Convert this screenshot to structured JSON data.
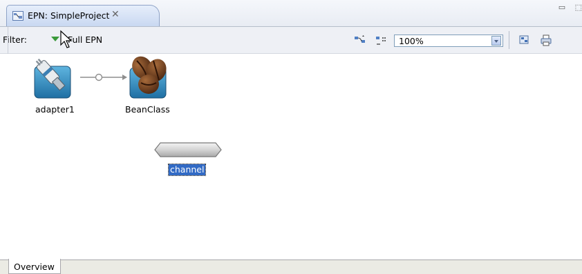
{
  "editor": {
    "tab_title": "EPN: SimpleProject",
    "tab_icon": "epn-diagram-icon",
    "close_glyph": "✕",
    "minimize_glyph": "▭",
    "maximize_glyph": "⬚"
  },
  "toolbar": {
    "filter_label": "Filter:",
    "filter_value": "Full EPN",
    "zoom_value": "100%",
    "icons": [
      "layout-icon",
      "grid-snap-icon",
      "export-image-icon",
      "print-icon"
    ]
  },
  "canvas": {
    "nodes": [
      {
        "id": "adapter1",
        "label": "adapter1",
        "icon": "adapter-plug-icon"
      },
      {
        "id": "beanclass",
        "label": "BeanClass",
        "icon": "coffee-bean-icon"
      },
      {
        "id": "channel",
        "label": "channel",
        "icon": "channel-capsule-icon",
        "selected": true
      }
    ],
    "connections": [
      {
        "from": "adapter1",
        "to": "BeanClass"
      }
    ]
  },
  "bottom_tabs": {
    "overview_label": "Overview"
  },
  "colors": {
    "selection": "#316ac5",
    "tab_active": "#c9d8f1",
    "filter_arrow": "#3a9a3a"
  }
}
